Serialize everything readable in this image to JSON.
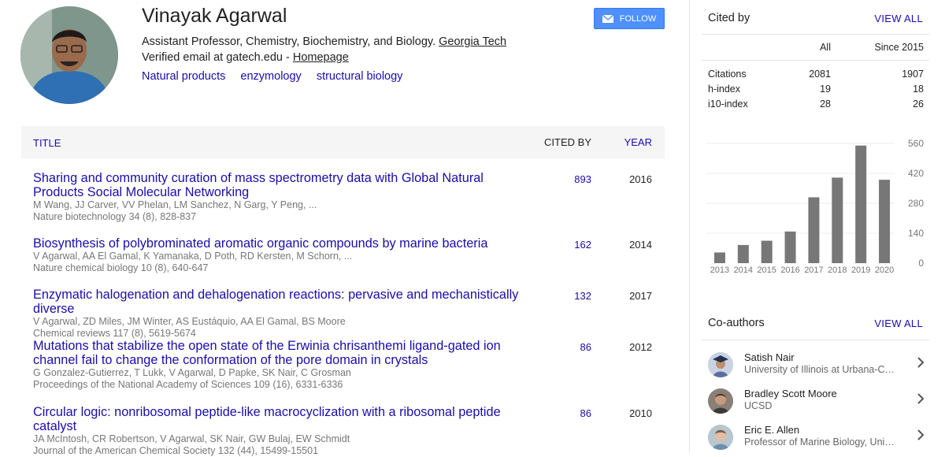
{
  "profile": {
    "name": "Vinayak Agarwal",
    "affiliation_prefix": "Assistant Professor, Chemistry, Biochemistry, and Biology.",
    "affiliation_link": "Georgia Tech",
    "email_text": "Verified email at gatech.edu -",
    "homepage_link": "Homepage",
    "interests": [
      "Natural products",
      "enzymology",
      "structural biology"
    ],
    "follow_label": "FOLLOW"
  },
  "table": {
    "col_title": "TITLE",
    "col_cited": "CITED BY",
    "col_year": "YEAR",
    "rows": [
      {
        "title": "Sharing and community curation of mass spectrometry data with Global Natural Products Social Molecular Networking",
        "authors": "M Wang, JJ Carver, VV Phelan, LM Sanchez, N Garg, Y Peng, ...",
        "venue": "Nature biotechnology 34 (8), 828-837",
        "cited": "893",
        "year": "2016"
      },
      {
        "title": "Biosynthesis of polybrominated aromatic organic compounds by marine bacteria",
        "authors": "V Agarwal, AA El Gamal, K Yamanaka, D Poth, RD Kersten, M Schorn, ...",
        "venue": "Nature chemical biology 10 (8), 640-647",
        "cited": "162",
        "year": "2014"
      },
      {
        "title": "Enzymatic halogenation and dehalogenation reactions: pervasive and mechanistically diverse",
        "authors": "V Agarwal, ZD Miles, JM Winter, AS Eustáquio, AA El Gamal, BS Moore",
        "venue": "Chemical reviews 117 (8), 5619-5674",
        "cited": "132",
        "year": "2017"
      },
      {
        "title": "Mutations that stabilize the open state of the Erwinia chrisanthemi ligand-gated ion channel fail to change the conformation of the pore domain in crystals",
        "authors": "G Gonzalez-Gutierrez, T Lukk, V Agarwal, D Papke, SK Nair, C Grosman",
        "venue": "Proceedings of the National Academy of Sciences 109 (16), 6331-6336",
        "cited": "86",
        "year": "2012"
      },
      {
        "title": "Circular logic: nonribosomal peptide-like macrocyclization with a ribosomal peptide catalyst",
        "authors": "JA McIntosh, CR Robertson, V Agarwal, SK Nair, GW Bulaj, EW Schmidt",
        "venue": "Journal of the American Chemical Society 132 (44), 15499-15501",
        "cited": "86",
        "year": "2010"
      }
    ]
  },
  "cited_by": {
    "title": "Cited by",
    "view_all": "VIEW ALL",
    "col_all": "All",
    "col_since": "Since 2015",
    "metrics": [
      {
        "label": "Citations",
        "all": "2081",
        "since": "1907"
      },
      {
        "label": "h-index",
        "all": "19",
        "since": "18"
      },
      {
        "label": "i10-index",
        "all": "28",
        "since": "26"
      }
    ]
  },
  "chart_data": {
    "type": "bar",
    "categories": [
      "2013",
      "2014",
      "2015",
      "2016",
      "2017",
      "2018",
      "2019",
      "2020"
    ],
    "values": [
      50,
      85,
      105,
      148,
      308,
      400,
      550,
      390
    ],
    "ylim": [
      0,
      560
    ],
    "yticks": [
      "560",
      "420",
      "280",
      "140",
      "0"
    ],
    "bar_color": "#777777"
  },
  "coauthors": {
    "title": "Co-authors",
    "view_all": "VIEW ALL",
    "list": [
      {
        "name": "Satish Nair",
        "affiliation": "University of Illinois at Urbana-Champaign"
      },
      {
        "name": "Bradley Scott Moore",
        "affiliation": "UCSD"
      },
      {
        "name": "Eric E. Allen",
        "affiliation": "Professor of Marine Biology, University of California San Diego"
      }
    ]
  }
}
